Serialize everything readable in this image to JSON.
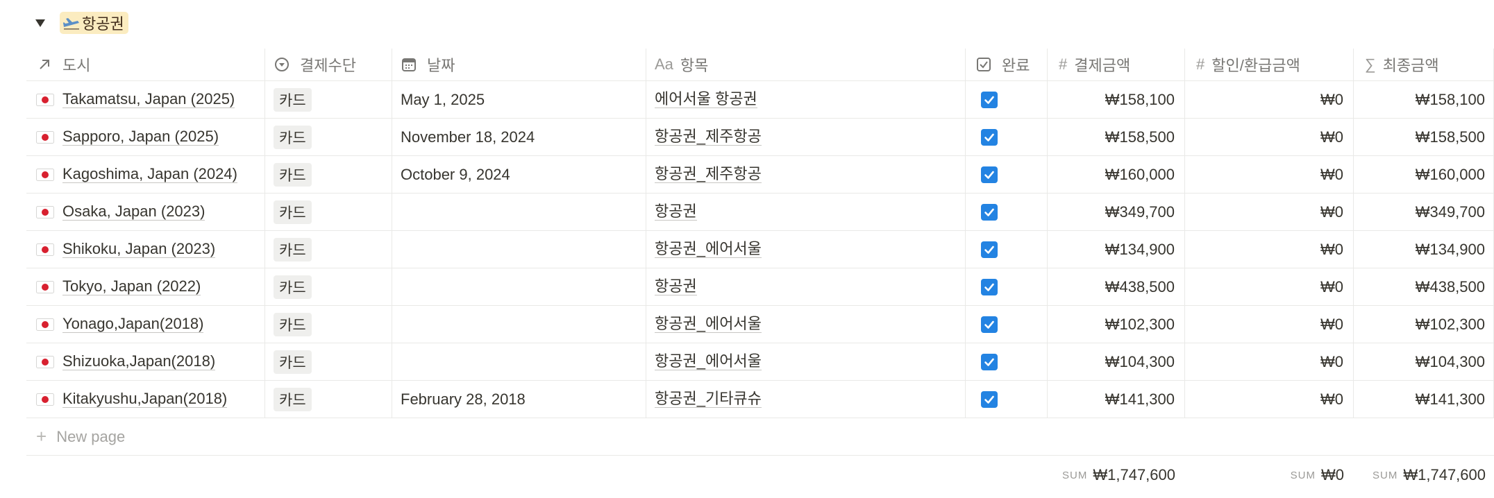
{
  "group": {
    "icon": "airplane-icon",
    "label": "항공권"
  },
  "columns": {
    "city": {
      "label": "도시",
      "icon": "relation-arrow-icon"
    },
    "pay": {
      "label": "결제수단",
      "icon": "select-circle-icon"
    },
    "date": {
      "label": "날짜",
      "icon": "calendar-icon"
    },
    "item": {
      "label": "항목",
      "icon_text": "Aa"
    },
    "done": {
      "label": "완료",
      "icon": "checkbox-icon"
    },
    "amount": {
      "label": "결제금액",
      "icon_text": "#"
    },
    "discount": {
      "label": "할인/환급금액",
      "icon_text": "#"
    },
    "final": {
      "label": "최종금액",
      "icon_text": "∑"
    }
  },
  "rows": [
    {
      "city": "Takamatsu, Japan (2025)",
      "pay": "카드",
      "date": "May 1, 2025",
      "item": "에어서울 항공권",
      "done": true,
      "amount": "₩158,100",
      "discount": "₩0",
      "final": "₩158,100"
    },
    {
      "city": "Sapporo, Japan (2025)",
      "pay": "카드",
      "date": "November 18, 2024",
      "item": "항공권_제주항공",
      "done": true,
      "amount": "₩158,500",
      "discount": "₩0",
      "final": "₩158,500"
    },
    {
      "city": "Kagoshima, Japan (2024)",
      "pay": "카드",
      "date": "October 9, 2024",
      "item": "항공권_제주항공",
      "done": true,
      "amount": "₩160,000",
      "discount": "₩0",
      "final": "₩160,000"
    },
    {
      "city": "Osaka, Japan (2023)",
      "pay": "카드",
      "date": "",
      "item": "항공권",
      "done": true,
      "amount": "₩349,700",
      "discount": "₩0",
      "final": "₩349,700"
    },
    {
      "city": "Shikoku, Japan (2023)",
      "pay": "카드",
      "date": "",
      "item": "항공권_에어서울",
      "done": true,
      "amount": "₩134,900",
      "discount": "₩0",
      "final": "₩134,900"
    },
    {
      "city": "Tokyo, Japan (2022)",
      "pay": "카드",
      "date": "",
      "item": "항공권",
      "done": true,
      "amount": "₩438,500",
      "discount": "₩0",
      "final": "₩438,500"
    },
    {
      "city": "Yonago,Japan(2018)",
      "pay": "카드",
      "date": "",
      "item": "항공권_에어서울",
      "done": true,
      "amount": "₩102,300",
      "discount": "₩0",
      "final": "₩102,300"
    },
    {
      "city": "Shizuoka,Japan(2018)",
      "pay": "카드",
      "date": "",
      "item": "항공권_에어서울",
      "done": true,
      "amount": "₩104,300",
      "discount": "₩0",
      "final": "₩104,300"
    },
    {
      "city": "Kitakyushu,Japan(2018)",
      "pay": "카드",
      "date": "February 28, 2018",
      "item": "항공권_기타큐슈",
      "done": true,
      "amount": "₩141,300",
      "discount": "₩0",
      "final": "₩141,300"
    }
  ],
  "new_page": {
    "label": "New page"
  },
  "sums": {
    "label": "SUM",
    "amount": "₩1,747,600",
    "discount": "₩0",
    "final": "₩1,747,600"
  },
  "colors": {
    "group_tag_bg": "#fbecc0",
    "checkbox": "#2383e2",
    "border": "#e9e9e7"
  }
}
